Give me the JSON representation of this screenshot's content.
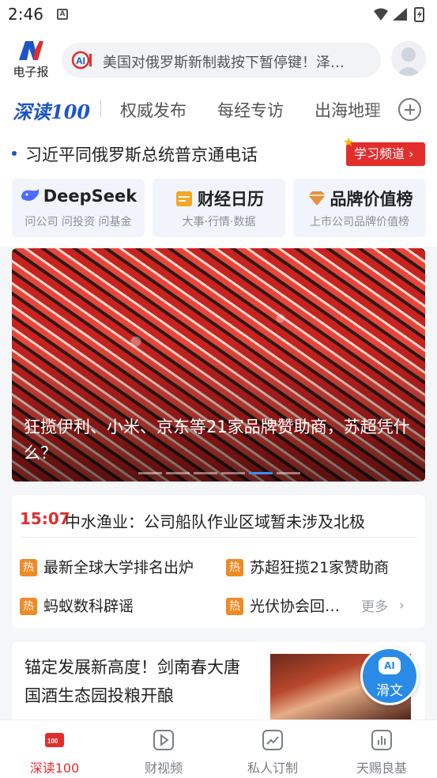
{
  "status_bar": {
    "time": "2:46",
    "notification_icon": "a-icon"
  },
  "header": {
    "logo_label": "电子报",
    "search_placeholder": "美国对俄罗斯新制裁按下暂停键！泽…"
  },
  "tabs": [
    {
      "label": "深读100",
      "active": true
    },
    {
      "label": "权威发布"
    },
    {
      "label": "每经专访"
    },
    {
      "label": "出海地理"
    }
  ],
  "headline": {
    "text": "习近平同俄罗斯总统普京通电话",
    "study_button": "学习频道"
  },
  "cards": [
    {
      "title": "DeepSeek",
      "subtitle": "问公司 问投资 问基金",
      "icon": "whale-icon"
    },
    {
      "title": "财经日历",
      "subtitle": "大事·行情·数据",
      "icon": "calendar-icon"
    },
    {
      "title": "品牌价值榜",
      "subtitle": "上市公司品牌价值榜",
      "icon": "diamond-icon"
    }
  ],
  "banner": {
    "caption": "狂揽伊利、小米、京东等21家品牌赞助商，苏超凭什么？",
    "dot_count": 6,
    "active_dot": 4
  },
  "flash": {
    "time": "15:07",
    "text": "中水渔业：公司船队作业区域暂未涉及北极",
    "hot_tag": "热",
    "hot_items": [
      "最新全球大学排名出炉",
      "苏超狂揽21家赞助商",
      "蚂蚁数科辟谣",
      "光伏协会回…"
    ],
    "more": "更多"
  },
  "article": {
    "title": "锚定发展新高度！剑南春大唐国酒生态园投粮开酿"
  },
  "ai_button": {
    "badge": "AI",
    "label": "滑文"
  },
  "bottom_nav": [
    {
      "label": "深读100",
      "icon": "shendu-icon",
      "active": true
    },
    {
      "label": "财视频",
      "icon": "video-icon"
    },
    {
      "label": "私人订制",
      "icon": "custom-icon"
    },
    {
      "label": "天赐良基",
      "icon": "fund-icon"
    }
  ],
  "colors": {
    "accent_red": "#e32d2d",
    "brand_blue": "#1d55c7",
    "hot_orange": "#f08a24"
  }
}
